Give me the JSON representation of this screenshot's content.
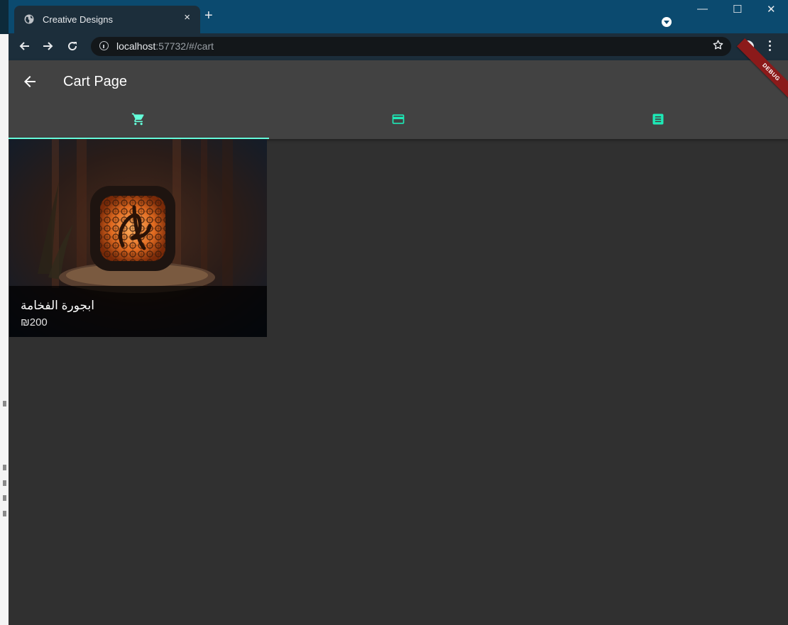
{
  "browser": {
    "tab_title": "Creative Designs",
    "tab_close": "×",
    "new_tab": "+",
    "url_host": "localhost",
    "url_path": ":57732/#/cart"
  },
  "window_controls": {
    "minimize": "—",
    "maximize": "☐",
    "close": "✕"
  },
  "appbar": {
    "title": "Cart Page",
    "debug_banner": "DEBUG"
  },
  "tabs": [
    {
      "icon": "shopping-cart-icon",
      "selected": true
    },
    {
      "icon": "credit-card-icon",
      "selected": false
    },
    {
      "icon": "receipt-list-icon",
      "selected": false
    }
  ],
  "colors": {
    "accent": "#64ffda",
    "tab_icon_inactive": "#1de9b6",
    "appbar": "#424242",
    "background": "#303030",
    "debug": "#8b1a1a"
  },
  "cart": {
    "items": [
      {
        "name": "ابجورة الفخامة",
        "price": "₪200"
      }
    ]
  }
}
